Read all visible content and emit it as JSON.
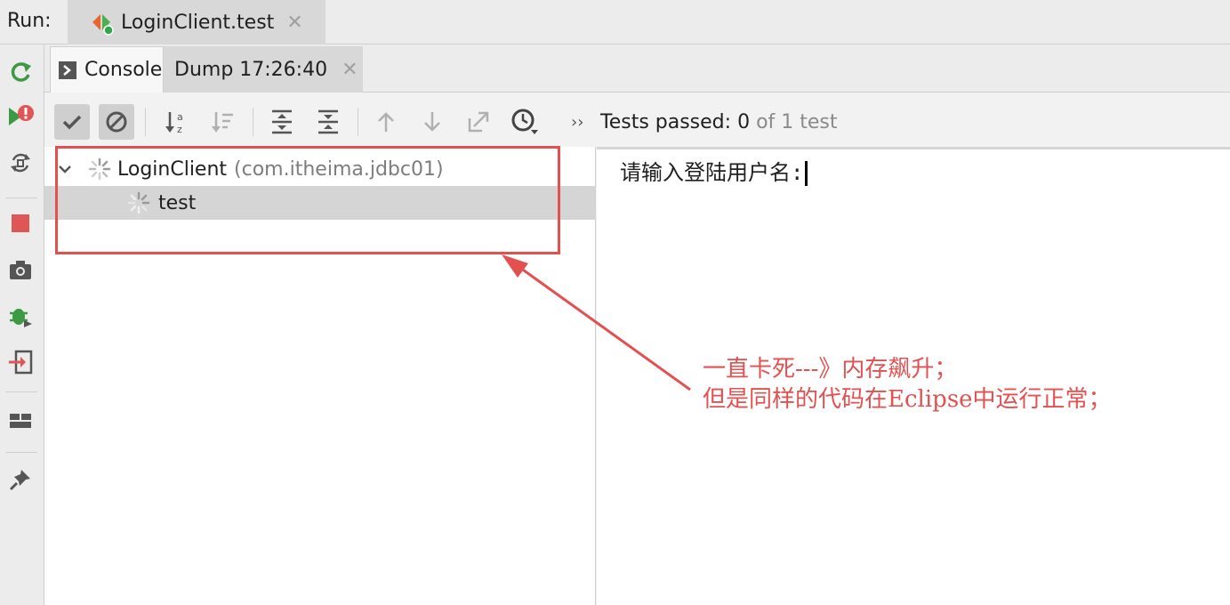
{
  "runbar": {
    "label": "Run:",
    "tab_title": "LoginClient.test",
    "close_glyph": "✕"
  },
  "tabs": {
    "console_label": "Console",
    "dump_label": "Dump 17:26:40",
    "close_glyph": "✕"
  },
  "toolbar": {
    "overflow_glyph": "››",
    "status_prefix": "Tests passed: ",
    "passed_count": "0",
    "status_suffix": "of 1 test"
  },
  "tree": {
    "items": [
      {
        "label": "LoginClient",
        "package": "(com.itheima.jdbc01)"
      },
      {
        "label": "test"
      }
    ]
  },
  "console": {
    "prompt_text": "请输入登陆用户名:"
  },
  "annotation": {
    "line1": "一直卡死---》内存飙升；",
    "line2": "但是同样的代码在Eclipse中运行正常；"
  },
  "colors": {
    "annotation_red": "#e35050",
    "run_green": "#4caf50",
    "stop_red": "#e05555"
  }
}
